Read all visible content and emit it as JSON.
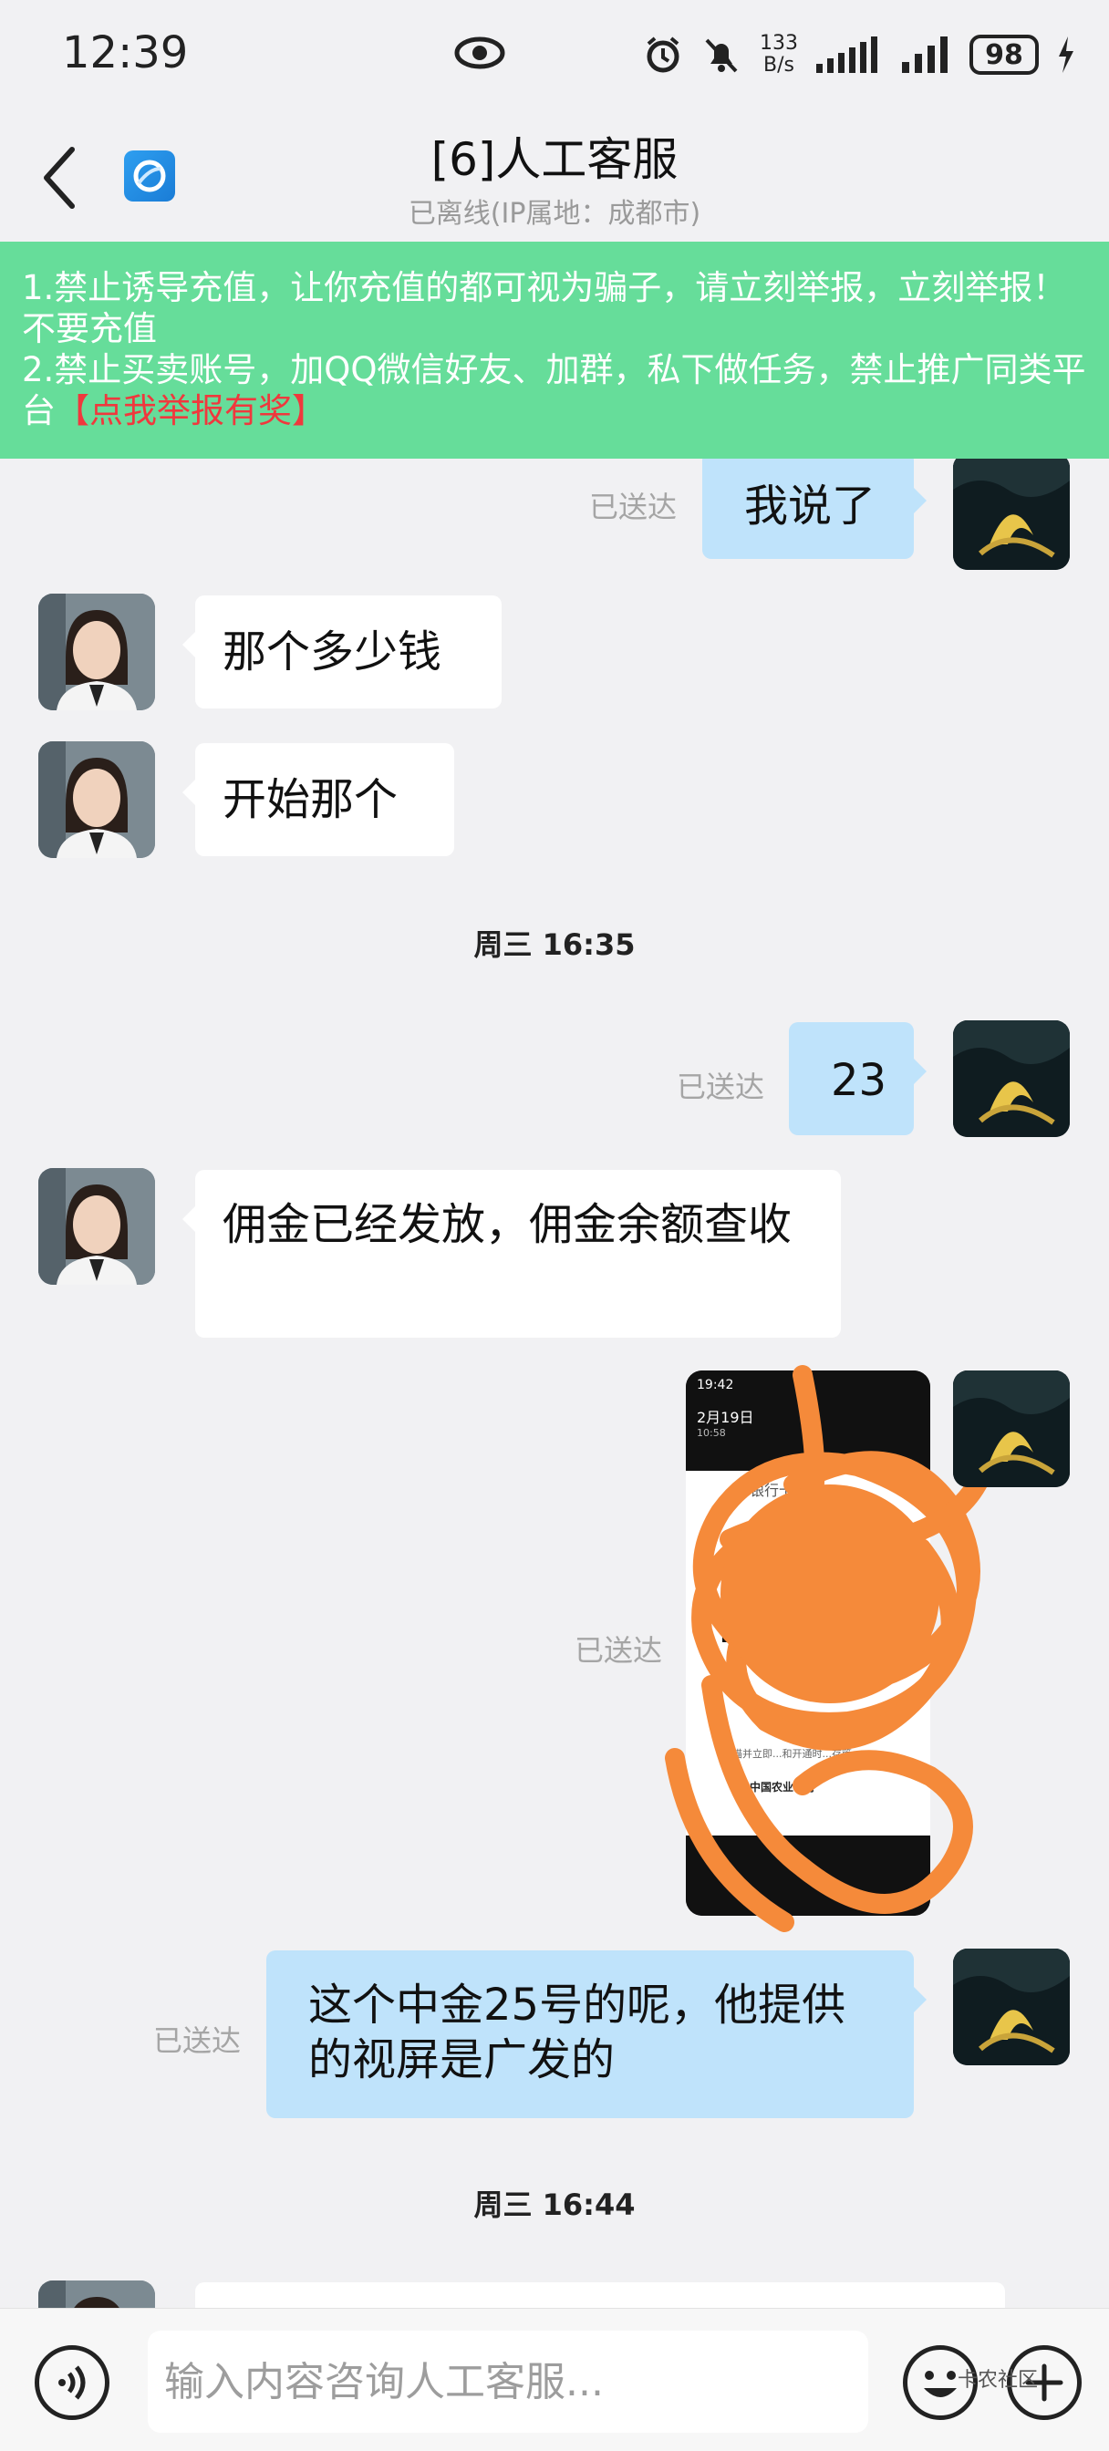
{
  "status_bar": {
    "time": "12:39",
    "net_rate_value": "133",
    "net_rate_unit": "B/s",
    "battery": "98"
  },
  "header": {
    "title": "[6]人工客服",
    "subtitle": "已离线(IP属地：成都市)"
  },
  "notice": {
    "line1": "1.禁止诱导充值，让你充值的都可视为骗子，请立刻举报，立刻举报！不要充值",
    "line2": "2.禁止买卖账号，加QQ微信好友、加群，私下做任务，禁止推广同类平台",
    "report_link": "【点我举报有奖】",
    "background": "#66dd9a",
    "link_color": "#f0383d"
  },
  "messages": [
    {
      "from": "user",
      "text": "我说了",
      "status": "已送达"
    },
    {
      "from": "agent",
      "text": "那个多少钱"
    },
    {
      "from": "agent",
      "text": "开始那个"
    },
    {
      "timestamp": "周三 16:35"
    },
    {
      "from": "user",
      "text": "23",
      "status": "已送达"
    },
    {
      "from": "agent",
      "text": "佣金已经发放，佣金余额查收"
    },
    {
      "from": "user",
      "type": "image",
      "status": "已送达",
      "image_text": {
        "time": "19:42",
        "date": "2月19日",
        "sub": "10:58",
        "bank_heading": "银行卡",
        "footer": "扫描并立即...和开通时...存管",
        "bank_name": "中国农业银行"
      }
    },
    {
      "from": "user",
      "text": "这个中金25号的呢，他提供的视屏是广发的",
      "status": "已送达"
    },
    {
      "timestamp": "周三 16:44"
    },
    {
      "from": "agent",
      "text": ""
    }
  ],
  "input": {
    "placeholder": "输入内容咨询人工客服..."
  },
  "watermark": "卡农社区",
  "icons": [
    "back-icon",
    "app-logo-icon",
    "voice-icon",
    "emoji-icon",
    "plus-icon",
    "eye-icon",
    "alarm-icon",
    "mute-icon",
    "signal-icon",
    "battery-icon"
  ]
}
